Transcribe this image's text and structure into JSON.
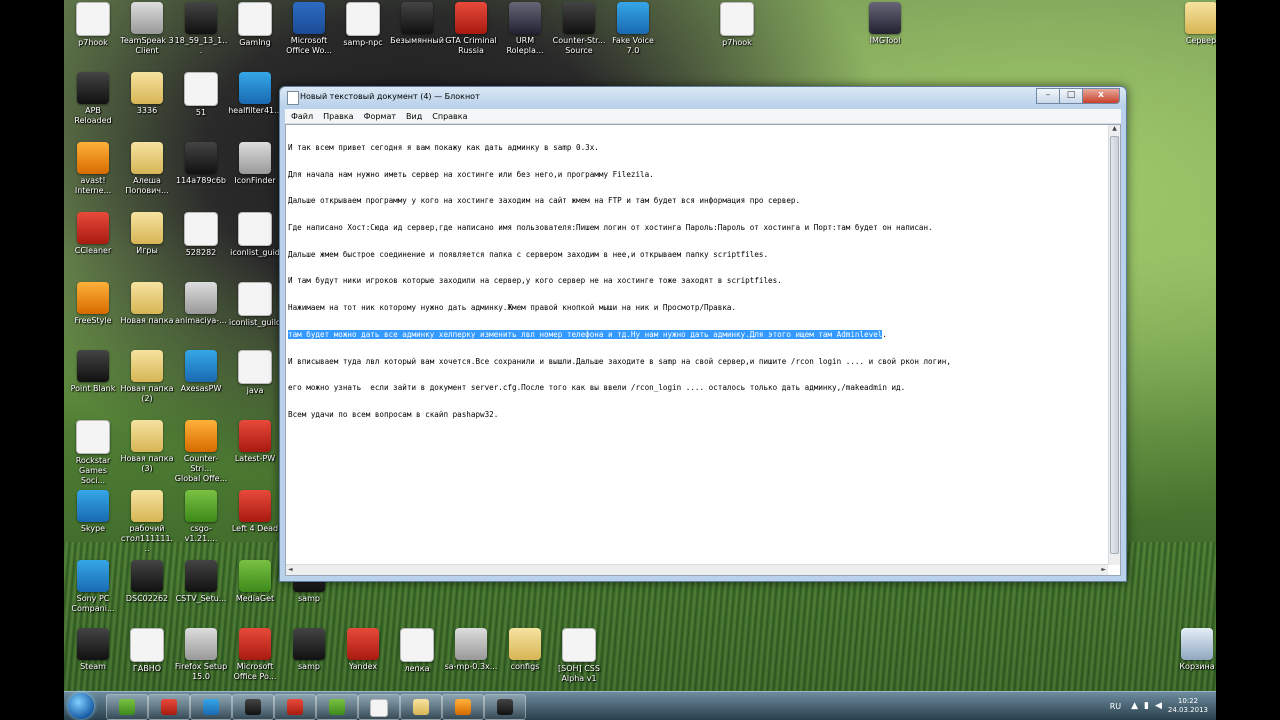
{
  "desktop_icons": [
    {
      "label": "p7hook",
      "kind": "doc"
    },
    {
      "label": "TeamSpeak 3\nClient",
      "kind": "gray"
    },
    {
      "label": "18_59_13_1...",
      "kind": "dark"
    },
    {
      "label": "GamIng",
      "kind": "doc"
    },
    {
      "label": "Microsoft\nOffice Wo...",
      "kind": "word"
    },
    {
      "label": "samp-npc",
      "kind": "doc"
    },
    {
      "label": "Безымянный",
      "kind": "dark"
    },
    {
      "label": "GTA Criminal\nRussia",
      "kind": "red"
    },
    {
      "label": "URM\nRolepla...",
      "kind": "app"
    },
    {
      "label": "Counter-Str...\nSource",
      "kind": "dark"
    },
    {
      "label": "Fake Voice\n7.0",
      "kind": "blue"
    },
    {
      "label": "p7hook",
      "kind": "doc"
    },
    {
      "label": "IMGTool",
      "kind": "app"
    },
    {
      "label": "Сервер",
      "kind": "folder"
    },
    {
      "label": "APB\nReloaded",
      "kind": "dark"
    },
    {
      "label": "3336",
      "kind": "folder"
    },
    {
      "label": "51",
      "kind": "doc"
    },
    {
      "label": "healfilter41...",
      "kind": "blue"
    },
    {
      "label": "avast!\nInterne...",
      "kind": "orange"
    },
    {
      "label": "Алеша\nПопович...",
      "kind": "folder"
    },
    {
      "label": "114a789c6b",
      "kind": "dark"
    },
    {
      "label": "IconFinder",
      "kind": "gray"
    },
    {
      "label": "CCleaner",
      "kind": "red"
    },
    {
      "label": "Игры",
      "kind": "folder"
    },
    {
      "label": "528282",
      "kind": "doc"
    },
    {
      "label": "iconlist_guid",
      "kind": "doc"
    },
    {
      "label": "FreeStyle",
      "kind": "orange"
    },
    {
      "label": "Новая папка",
      "kind": "folder"
    },
    {
      "label": "animaciya-...",
      "kind": "gray"
    },
    {
      "label": "iconlist_guild",
      "kind": "doc"
    },
    {
      "label": "Point Blank",
      "kind": "dark"
    },
    {
      "label": "Новая папка\n(2)",
      "kind": "folder"
    },
    {
      "label": "AxesasPW",
      "kind": "blue"
    },
    {
      "label": "java",
      "kind": "doc"
    },
    {
      "label": "Rockstar\nGames Soci...",
      "kind": "doc"
    },
    {
      "label": "Новая папка\n(3)",
      "kind": "folder"
    },
    {
      "label": "Counter-Stri...\nGlobal Offe...",
      "kind": "orange"
    },
    {
      "label": "Latest-PW",
      "kind": "red"
    },
    {
      "label": "Skype",
      "kind": "blue"
    },
    {
      "label": "рабочий\nстол111111...",
      "kind": "folder"
    },
    {
      "label": "csgo-v1.21....",
      "kind": "green"
    },
    {
      "label": "Left 4 Dead",
      "kind": "red"
    },
    {
      "label": "Sony PC\nCompani...",
      "kind": "blue"
    },
    {
      "label": "DSC02262",
      "kind": "dark"
    },
    {
      "label": "CSTV_Setu...",
      "kind": "dark"
    },
    {
      "label": "MediaGet",
      "kind": "green"
    },
    {
      "label": "samp",
      "kind": "dark"
    },
    {
      "label": "Steam",
      "kind": "dark"
    },
    {
      "label": "ГАВНО",
      "kind": "doc"
    },
    {
      "label": "Firefox Setup\n15.0",
      "kind": "gray"
    },
    {
      "label": "Microsoft\nOffice Po...",
      "kind": "red"
    },
    {
      "label": "samp",
      "kind": "dark"
    },
    {
      "label": "Yandex",
      "kind": "red"
    },
    {
      "label": "лепка",
      "kind": "doc"
    },
    {
      "label": "sa-mp-0.3x...",
      "kind": "gray"
    },
    {
      "label": "configs",
      "kind": "folder"
    },
    {
      "label": "[SOH] CSS\nAlpha v1",
      "kind": "doc"
    },
    {
      "label": "Корзина",
      "kind": "bin"
    }
  ],
  "notepad": {
    "title": "Новый текстовый документ (4) — Блокнот",
    "buttons": {
      "minimize": "–",
      "maximize": "□",
      "close": "x"
    },
    "menu": [
      "Файл",
      "Правка",
      "Формат",
      "Вид",
      "Справка"
    ],
    "lines_before": [
      "И так всем привет сегодня я вам покажу как дать админку в samp 0.3x.",
      "Для начала нам нужно иметь сервер на хостинге или без него,и программу Filezila.",
      "Дальше открываем программу у кого на хостинге заходим на сайт жмем на FTP и там будет вся информация про сервер.",
      "Где написано Хост:Сюда ид сервер,где написано имя пользователя:Пишем логин от хостинга Пароль:Пароль от хостинга и Порт:там будет он написан.",
      "Дальше жмем быстрое соединение и появляется папка с сервером заходим в нее,и открываем папку scriptfiles.",
      "И там будут ники игроков которые заходили на сервер,у кого сервер не на хостинге тоже заходят в scriptfiles.",
      "Нажимаем на тот ник которому нужно дать админку.Жмем правой кнопкой мыши на ник и Просмотр/Правка."
    ],
    "selected_line": "там будет можно дать все админку хелперку изменить лвл номер телефона и тд.Ну нам нужно дать админку.Для этого ищем там Adminlevel",
    "selected_line_tail": ".",
    "lines_after": [
      "И вписываем туда лвл который вам хочется.Все сохранили и вышли.Дальше заходите в samp на свой сервер,и пишите /rcon login .... и свой ркон логин,",
      "его можно узнать  если зайти в документ server.cfg.После того как вы ввели /rcon_login .... осталось только дать админку,/makeadmin ид.",
      "Всем удачи по всем вопросам в скайп pashapw32."
    ]
  },
  "taskbar": {
    "language": "RU",
    "time": "10:22",
    "date": "24.03.2013"
  }
}
